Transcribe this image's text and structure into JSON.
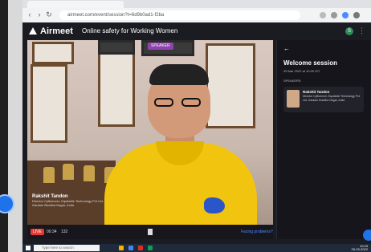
{
  "browser": {
    "url": "airmeet.com/event/session?t=6d9b0ad1-f2ba"
  },
  "app": {
    "brand": "Airmeet",
    "event_title": "Online safety for Working Women",
    "user_initial": "S",
    "menu_glyph": "⋮"
  },
  "stage": {
    "speaker_badge": "SPEAKER",
    "speaker_name": "Rakshit Tandon",
    "speaker_desc": "Director Cyfluencer, Equitable Technology Pvt Ltd, Gautam Buddha Nagar, India"
  },
  "controls": {
    "live_label": "LIVE",
    "timer": "00:34",
    "viewer_count": "132",
    "facing_problems": "Facing problems?"
  },
  "side_panel": {
    "back_glyph": "←",
    "title": "Welcome session",
    "date": "25 Mar 2022 at 10:00 IST",
    "speakers_label": "Speakers",
    "speaker_name": "Rakshit Tandon",
    "speaker_desc": "Director Cyfluencer, Equitable Technology Pvt Ltd, Gautam Buddha Nagar, India"
  },
  "taskbar": {
    "search_placeholder": "Type here to search",
    "time": "10:23",
    "date": "25-03-2022"
  },
  "colors": {
    "accent": "#4a8cff",
    "live": "#e53935",
    "speaker_badge": "#8e44ad",
    "shirt": "#f1c40f"
  }
}
